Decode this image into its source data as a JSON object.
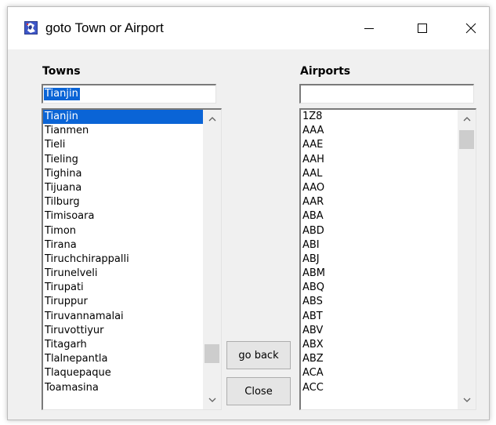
{
  "window": {
    "title": "goto Town or Airport"
  },
  "towns": {
    "label": "Towns",
    "input_value": "Tianjin",
    "items": [
      "Tianjin",
      "Tianmen",
      "Tieli",
      "Tieling",
      "Tighina",
      "Tijuana",
      "Tilburg",
      "Timisoara",
      "Timon",
      "Tirana",
      "Tiruchchirappalli",
      "Tirunelveli",
      "Tirupati",
      "Tiruppur",
      "Tiruvannamalai",
      "Tiruvottiyur",
      "Titagarh",
      "Tlalnepantla",
      "Tlaquepaque",
      "Toamasina"
    ],
    "selected_index": 0
  },
  "airports": {
    "label": "Airports",
    "input_value": "",
    "items": [
      "1Z8",
      "AAA",
      "AAE",
      "AAH",
      "AAL",
      "AAO",
      "AAR",
      "ABA",
      "ABD",
      "ABI",
      "ABJ",
      "ABM",
      "ABQ",
      "ABS",
      "ABT",
      "ABV",
      "ABX",
      "ABZ",
      "ACA",
      "ACC"
    ]
  },
  "buttons": {
    "go_back": "go back",
    "close": "Close"
  },
  "icons": {
    "app": "app-icon",
    "minimize": "minimize-icon",
    "maximize": "maximize-icon",
    "close": "close-icon",
    "scroll_up": "chevron-up-icon",
    "scroll_down": "chevron-down-icon"
  },
  "colors": {
    "selection": "#0a64d6",
    "dialog_bg": "#f0f0f0",
    "button_bg": "#e5e5e5"
  }
}
